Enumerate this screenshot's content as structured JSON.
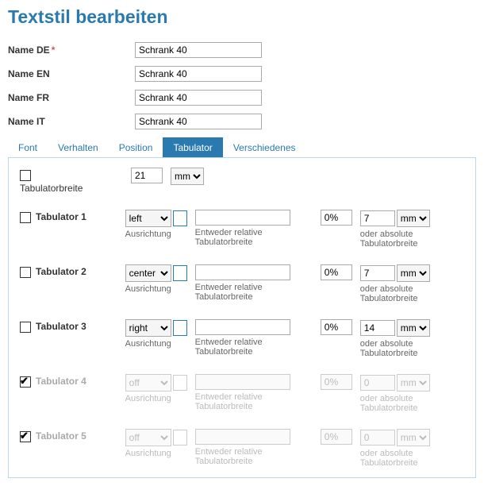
{
  "title": "Textstil bearbeiten",
  "fields": {
    "name_de": {
      "label": "Name DE",
      "required": true,
      "value": "Schrank 40"
    },
    "name_en": {
      "label": "Name EN",
      "value": "Schrank 40"
    },
    "name_fr": {
      "label": "Name FR",
      "value": "Schrank 40"
    },
    "name_it": {
      "label": "Name IT",
      "value": "Schrank 40"
    }
  },
  "tabs": {
    "font": "Font",
    "verhalten": "Verhalten",
    "position": "Position",
    "tabulator": "Tabulator",
    "verschiedenes": "Verschiedenes"
  },
  "captions": {
    "ausrichtung": "Ausrichtung",
    "rel": "Entweder relative Tabulatorbreite",
    "abs": "oder absolute Tabulatorbreite"
  },
  "tabWidth": {
    "label": "Tabulatorbreite",
    "value": "21",
    "unit": "mm"
  },
  "rows": [
    {
      "label": "Tabulator 1",
      "checked": false,
      "enabled": true,
      "align": "left",
      "relVal": "",
      "pct": "0%",
      "abs": "7",
      "unit": "mm"
    },
    {
      "label": "Tabulator 2",
      "checked": false,
      "enabled": true,
      "align": "center",
      "relVal": "",
      "pct": "0%",
      "abs": "7",
      "unit": "mm"
    },
    {
      "label": "Tabulator 3",
      "checked": false,
      "enabled": true,
      "align": "right",
      "relVal": "",
      "pct": "0%",
      "abs": "14",
      "unit": "mm"
    },
    {
      "label": "Tabulator 4",
      "checked": true,
      "enabled": false,
      "align": "off",
      "relVal": "",
      "pct": "0%",
      "abs": "0",
      "unit": "mm"
    },
    {
      "label": "Tabulator 5",
      "checked": true,
      "enabled": false,
      "align": "off",
      "relVal": "",
      "pct": "0%",
      "abs": "0",
      "unit": "mm"
    }
  ]
}
